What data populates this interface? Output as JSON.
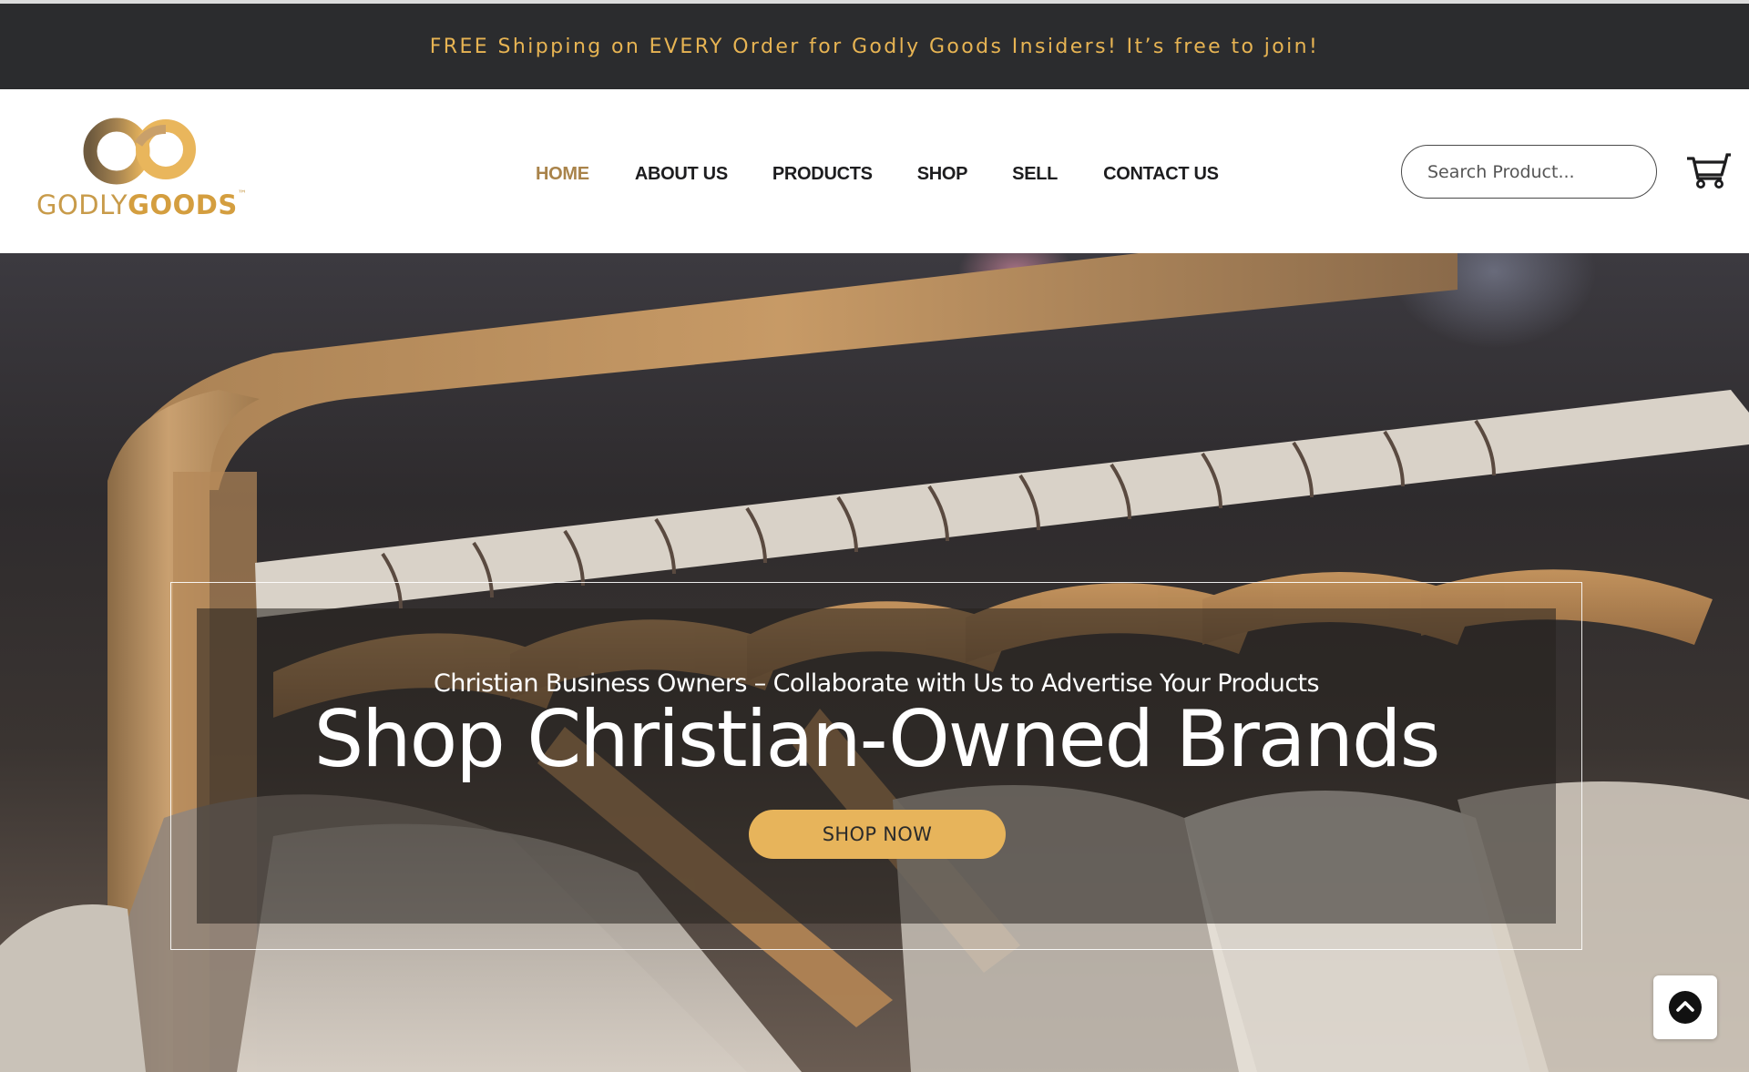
{
  "announcement": {
    "text": "FREE Shipping on EVERY Order for Godly Goods Insiders! It’s free to join!"
  },
  "logo": {
    "word_light": "GODLY",
    "word_bold": "GOODS",
    "trademark": "™",
    "icon": "infinity-logo-icon"
  },
  "nav": {
    "items": [
      {
        "label": "HOME",
        "active": true
      },
      {
        "label": "ABOUT US",
        "active": false
      },
      {
        "label": "PRODUCTS",
        "active": false
      },
      {
        "label": "SHOP",
        "active": false
      },
      {
        "label": "SELL",
        "active": false
      },
      {
        "label": "CONTACT US",
        "active": false
      }
    ]
  },
  "search": {
    "placeholder": "Search Product..."
  },
  "cart": {
    "icon": "cart-icon"
  },
  "hero": {
    "subtitle": "Christian Business Owners – Collaborate with Us to Advertise Your Products",
    "title": "Shop Christian-Owned Brands",
    "button_label": "SHOP NOW"
  },
  "scroll_top": {
    "icon": "chevron-up-icon"
  },
  "colors": {
    "announce_bg": "#2b2c2e",
    "announce_text": "#e7b453",
    "nav_active": "#a9834a",
    "button_bg": "#e7b45b",
    "logo_gold": "#c89b4a"
  }
}
